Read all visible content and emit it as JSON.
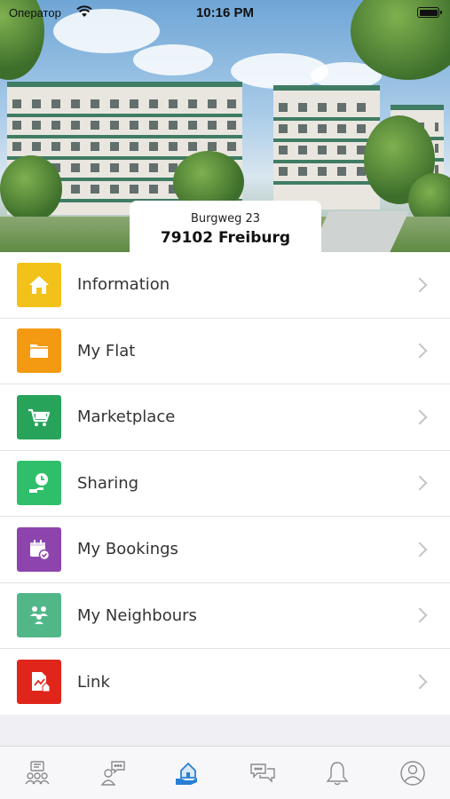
{
  "status_bar": {
    "carrier": "Оператор",
    "time": "10:16 PM",
    "battery_level": 1.0
  },
  "address": {
    "street": "Burgweg 23",
    "city": "79102 Freiburg"
  },
  "menu": {
    "items": [
      {
        "label": "Information",
        "icon": "house-icon",
        "color": "#f2c21a"
      },
      {
        "label": "My Flat",
        "icon": "folder-icon",
        "color": "#f39a12"
      },
      {
        "label": "Marketplace",
        "icon": "shopping-cart-icon",
        "color": "#27a35a"
      },
      {
        "label": "Sharing",
        "icon": "hand-clock-icon",
        "color": "#2fbf6a"
      },
      {
        "label": "My Bookings",
        "icon": "calendar-check-icon",
        "color": "#8e44ad"
      },
      {
        "label": "My Neighbours",
        "icon": "people-icon",
        "color": "#52b788"
      },
      {
        "label": "Link",
        "icon": "document-link-icon",
        "color": "#e0261b"
      }
    ]
  },
  "tab_bar": {
    "tabs": [
      {
        "icon": "community-board-icon",
        "active": false
      },
      {
        "icon": "chat-person-icon",
        "active": false
      },
      {
        "icon": "home-hand-icon",
        "active": true
      },
      {
        "icon": "messages-icon",
        "active": false
      },
      {
        "icon": "bell-icon",
        "active": false
      },
      {
        "icon": "profile-icon",
        "active": false
      }
    ],
    "active_color": "#2a7fd4",
    "inactive_color": "#8a8a8e"
  }
}
